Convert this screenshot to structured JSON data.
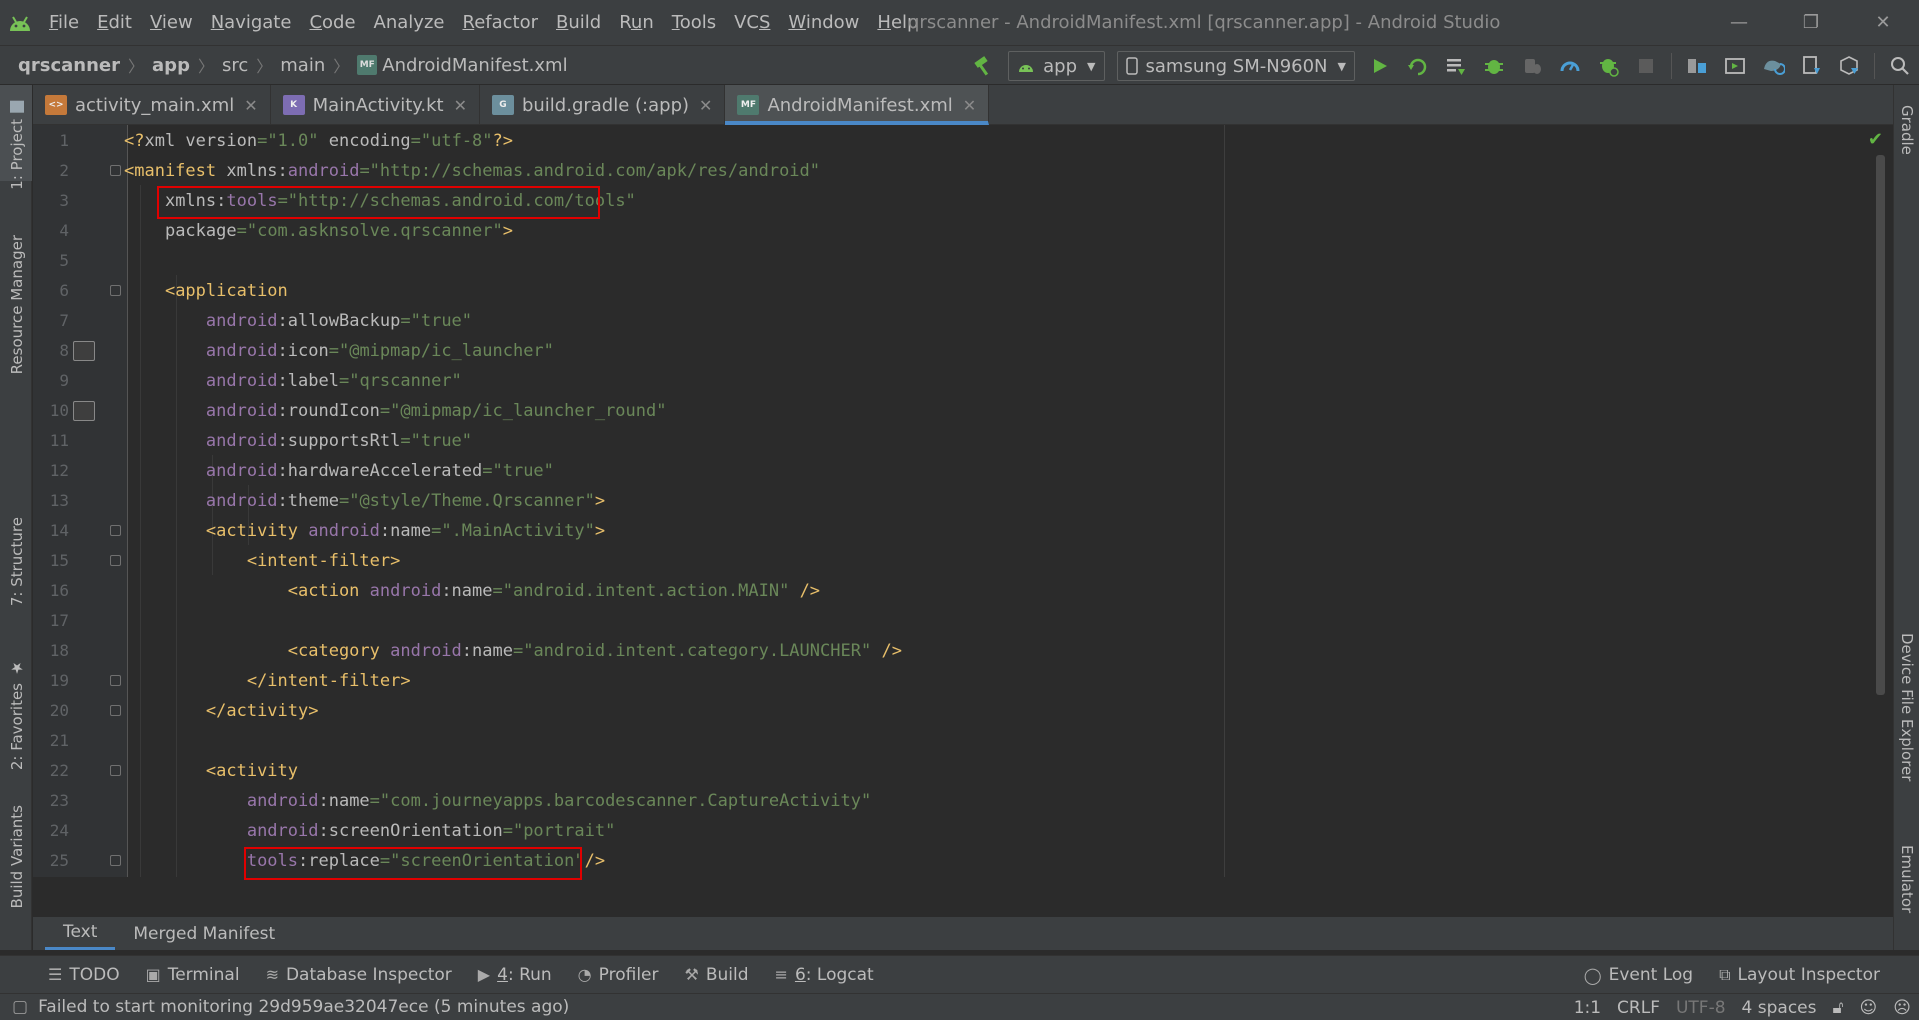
{
  "window": {
    "title": "qrscanner - AndroidManifest.xml [qrscanner.app] - Android Studio",
    "minimize": "—",
    "restore": "❐",
    "close": "✕"
  },
  "menu": [
    {
      "u": "F",
      "rest": "ile"
    },
    {
      "u": "E",
      "rest": "dit"
    },
    {
      "u": "V",
      "rest": "iew"
    },
    {
      "u": "N",
      "rest": "avigate"
    },
    {
      "u": "C",
      "rest": "ode"
    },
    {
      "u": "",
      "rest": "Analyze"
    },
    {
      "u": "R",
      "rest": "efactor"
    },
    {
      "u": "B",
      "rest": "uild"
    },
    {
      "u": "",
      "pre": "R",
      "u2": "u",
      "rest": "n"
    },
    {
      "u": "T",
      "rest": "ools"
    },
    {
      "u": "",
      "pre": "VC",
      "u2": "S",
      "rest": ""
    },
    {
      "u": "W",
      "rest": "indow"
    },
    {
      "u": "H",
      "rest": "elp"
    }
  ],
  "breadcrumb": {
    "project": "qrscanner",
    "module": "app",
    "src": "src",
    "main": "main",
    "file": "AndroidManifest.xml",
    "file_badge": "MF"
  },
  "toolbar": {
    "run_config": "app",
    "device": "samsung SM-N960N"
  },
  "left_tabs": {
    "project": "1: Project",
    "resource_manager": "Resource Manager",
    "structure": "7: Structure",
    "favorites": "2: Favorites",
    "build_variants": "Build Variants"
  },
  "right_tabs": {
    "gradle": "Gradle",
    "device_file_explorer": "Device File Explorer",
    "emulator": "Emulator"
  },
  "tabs": [
    {
      "label": "activity_main.xml",
      "close": "✕",
      "badge": "<>",
      "color": "#c5793a"
    },
    {
      "label": "MainActivity.kt",
      "close": "✕",
      "badge": "K",
      "color": "#7d6db3"
    },
    {
      "label": "build.gradle (:app)",
      "close": "✕",
      "badge": "G",
      "color": "#6c8f9d"
    },
    {
      "label": "AndroidManifest.xml",
      "close": "✕",
      "badge": "MF",
      "color": "#4f7a6e"
    }
  ],
  "code_lines": [
    {
      "n": "1",
      "html": "<span class=\"t-tag\">&lt;?</span><span class=\"t-attr\">xml version</span><span class=\"t-val\">=\"1.0\"</span> <span class=\"t-attr\">encoding</span><span class=\"t-val\">=\"utf-8\"</span><span class=\"t-tag\">?&gt;</span>"
    },
    {
      "n": "2",
      "html": "<span class=\"t-tag\">&lt;manifest </span><span class=\"t-attr\">xmlns:</span><span class=\"t-ns\">android</span><span class=\"t-val\">=\"http://schemas.android.com/apk/res/android\"</span>"
    },
    {
      "n": "3",
      "html": "    <span class=\"t-attr\">xmlns:</span><span class=\"t-ns\">tools</span><span class=\"t-val\">=\"http://schemas.android.com/tools\"</span>"
    },
    {
      "n": "4",
      "html": "    <span class=\"t-attr\">package</span><span class=\"t-val\">=\"com.asknsolve.qrscanner\"</span><span class=\"t-tag\">&gt;</span>"
    },
    {
      "n": "5",
      "html": ""
    },
    {
      "n": "6",
      "html": "    <span class=\"t-tag\">&lt;application</span>"
    },
    {
      "n": "7",
      "html": "        <span class=\"t-ns\">android</span><span class=\"t-attr\">:allowBackup</span><span class=\"t-val\">=\"true\"</span>"
    },
    {
      "n": "8",
      "html": "        <span class=\"t-ns\">android</span><span class=\"t-attr\">:icon</span><span class=\"t-val\">=\"@mipmap/ic_launcher\"</span>"
    },
    {
      "n": "9",
      "html": "        <span class=\"t-ns\">android</span><span class=\"t-attr\">:label</span><span class=\"t-val\">=\"qrscanner\"</span>"
    },
    {
      "n": "10",
      "html": "        <span class=\"t-ns\">android</span><span class=\"t-attr\">:roundIcon</span><span class=\"t-val\">=\"@mipmap/ic_launcher_round\"</span>"
    },
    {
      "n": "11",
      "html": "        <span class=\"t-ns\">android</span><span class=\"t-attr\">:supportsRtl</span><span class=\"t-val\">=\"true\"</span>"
    },
    {
      "n": "12",
      "html": "        <span class=\"t-ns\">android</span><span class=\"t-attr\">:hardwareAccelerated</span><span class=\"t-val\">=\"true\"</span>"
    },
    {
      "n": "13",
      "html": "        <span class=\"t-ns\">android</span><span class=\"t-attr\">:theme</span><span class=\"t-val\">=\"@style/Theme.Qrscanner\"</span><span class=\"t-tag\">&gt;</span>"
    },
    {
      "n": "14",
      "html": "        <span class=\"t-tag\">&lt;activity </span><span class=\"t-ns\">android</span><span class=\"t-attr\">:name</span><span class=\"t-val\">=\".MainActivity\"</span><span class=\"t-tag\">&gt;</span>"
    },
    {
      "n": "15",
      "html": "            <span class=\"t-tag\">&lt;intent-filter&gt;</span>"
    },
    {
      "n": "16",
      "html": "                <span class=\"t-tag\">&lt;action </span><span class=\"t-ns\">android</span><span class=\"t-attr\">:name</span><span class=\"t-val\">=\"android.intent.action.MAIN\"</span> <span class=\"t-tag\">/&gt;</span>"
    },
    {
      "n": "17",
      "html": ""
    },
    {
      "n": "18",
      "html": "                <span class=\"t-tag\">&lt;category </span><span class=\"t-ns\">android</span><span class=\"t-attr\">:name</span><span class=\"t-val\">=\"android.intent.category.LAUNCHER\"</span> <span class=\"t-tag\">/&gt;</span>"
    },
    {
      "n": "19",
      "html": "            <span class=\"t-tag\">&lt;/intent-filter&gt;</span>"
    },
    {
      "n": "20",
      "html": "        <span class=\"t-tag\">&lt;/activity&gt;</span>"
    },
    {
      "n": "21",
      "html": ""
    },
    {
      "n": "22",
      "html": "        <span class=\"t-tag\">&lt;activity</span>"
    },
    {
      "n": "23",
      "html": "            <span class=\"t-ns\">android</span><span class=\"t-attr\">:name</span><span class=\"t-val\">=\"com.journeyapps.barcodescanner.CaptureActivity\"</span>"
    },
    {
      "n": "24",
      "html": "            <span class=\"t-ns\">android</span><span class=\"t-attr\">:screenOrientation</span><span class=\"t-val\">=\"portrait\"</span>"
    },
    {
      "n": "25",
      "html": "            <span class=\"t-ns\">tools</span><span class=\"t-attr\">:replace</span><span class=\"t-val\">=\"screenOrientation\"</span><span class=\"t-tag\">/&gt;</span>"
    }
  ],
  "editor_tabs": {
    "text": "Text",
    "merged": "Merged Manifest"
  },
  "tool_windows": {
    "todo": "TODO",
    "terminal": "Terminal",
    "database": "Database Inspector",
    "run_u": "4",
    "run_rest": ": Run",
    "profiler": "Profiler",
    "build": "Build",
    "logcat_u": "6",
    "logcat_rest": ": Logcat",
    "event_log": "Event Log",
    "layout_inspector": "Layout Inspector"
  },
  "status": {
    "message": "Failed to start monitoring 29d959ae32047ece (5 minutes ago)",
    "position": "1:1",
    "line_sep": "CRLF",
    "encoding": "UTF-8",
    "indent": "4 spaces"
  },
  "colors": {
    "accent": "#4a88c7",
    "highlight_box": "#e00000",
    "run_green": "#62b543"
  }
}
